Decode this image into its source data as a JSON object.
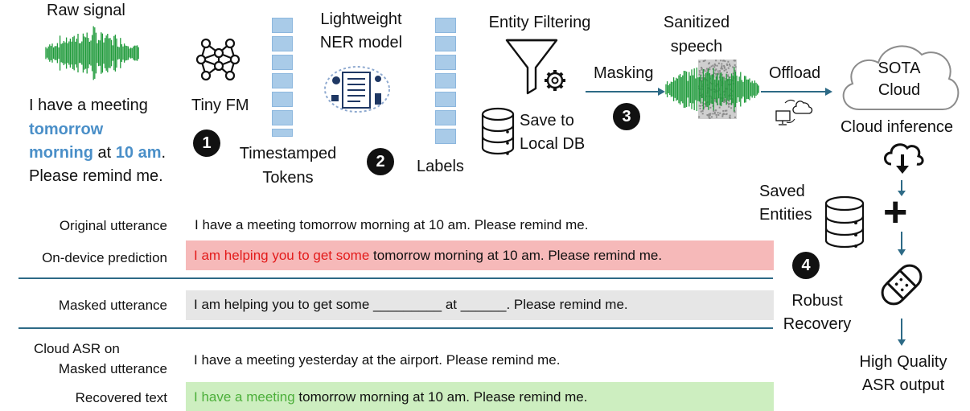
{
  "pipeline": {
    "raw_signal": "Raw signal",
    "tiny_fm": "Tiny FM",
    "ner_line1": "Lightweight",
    "ner_line2": "NER model",
    "entity_filtering": "Entity Filtering",
    "sanitized_line1": "Sanitized",
    "sanitized_line2": "speech",
    "timestamped_line1": "Timestamped",
    "timestamped_line2": "Tokens",
    "labels": "Labels",
    "save_line1": "Save to",
    "save_line2": "Local DB",
    "masking": "Masking",
    "offload": "Offload",
    "cloud_line1": "SOTA",
    "cloud_line2": "Cloud",
    "cloud_inference": "Cloud inference",
    "saved_line1": "Saved",
    "saved_line2": "Entities",
    "robust_line1": "Robust",
    "robust_line2": "Recovery",
    "hq_line1": "High Quality",
    "hq_line2": "ASR output",
    "plus": "+"
  },
  "steps": [
    "1",
    "2",
    "3",
    "4"
  ],
  "utterance": {
    "l1": "I have a meeting",
    "l2_hl": "tomorrow",
    "l3_hl1": "morning",
    "l3_mid": " at ",
    "l3_hl2": "10 am",
    "l3_end": ".",
    "l4": "Please remind me."
  },
  "rows": {
    "original": {
      "label": "Original utterance",
      "text": "I have a meeting tomorrow morning at 10 am. Please remind me."
    },
    "ondevice": {
      "label": "On-device prediction",
      "err": "I am helping you to get some",
      "rest": " tomorrow morning at 10 am. Please remind me."
    },
    "masked": {
      "label": "Masked utterance",
      "text": "I am helping you to get some  _________  at ______. Please remind me."
    },
    "cloud": {
      "label1": "Cloud ASR on",
      "label2": "Masked utterance",
      "text": "I have a meeting yesterday at the airport. Please remind me."
    },
    "recovered": {
      "label": "Recovered text",
      "good": "I have a meeting",
      "rest": " tomorrow morning at 10 am. Please remind me."
    }
  },
  "colors": {
    "accent_blue": "#4a8fc8",
    "token_blue": "#a9cbe8",
    "waveform_green": "#1f9a3a",
    "arrow": "#2d6a86",
    "error_bg": "#f6b9b9",
    "error_text": "#e31b1b",
    "masked_bg": "#e6e6e6",
    "recovered_bg": "#cdeec0",
    "recovered_text": "#4caf3a"
  }
}
